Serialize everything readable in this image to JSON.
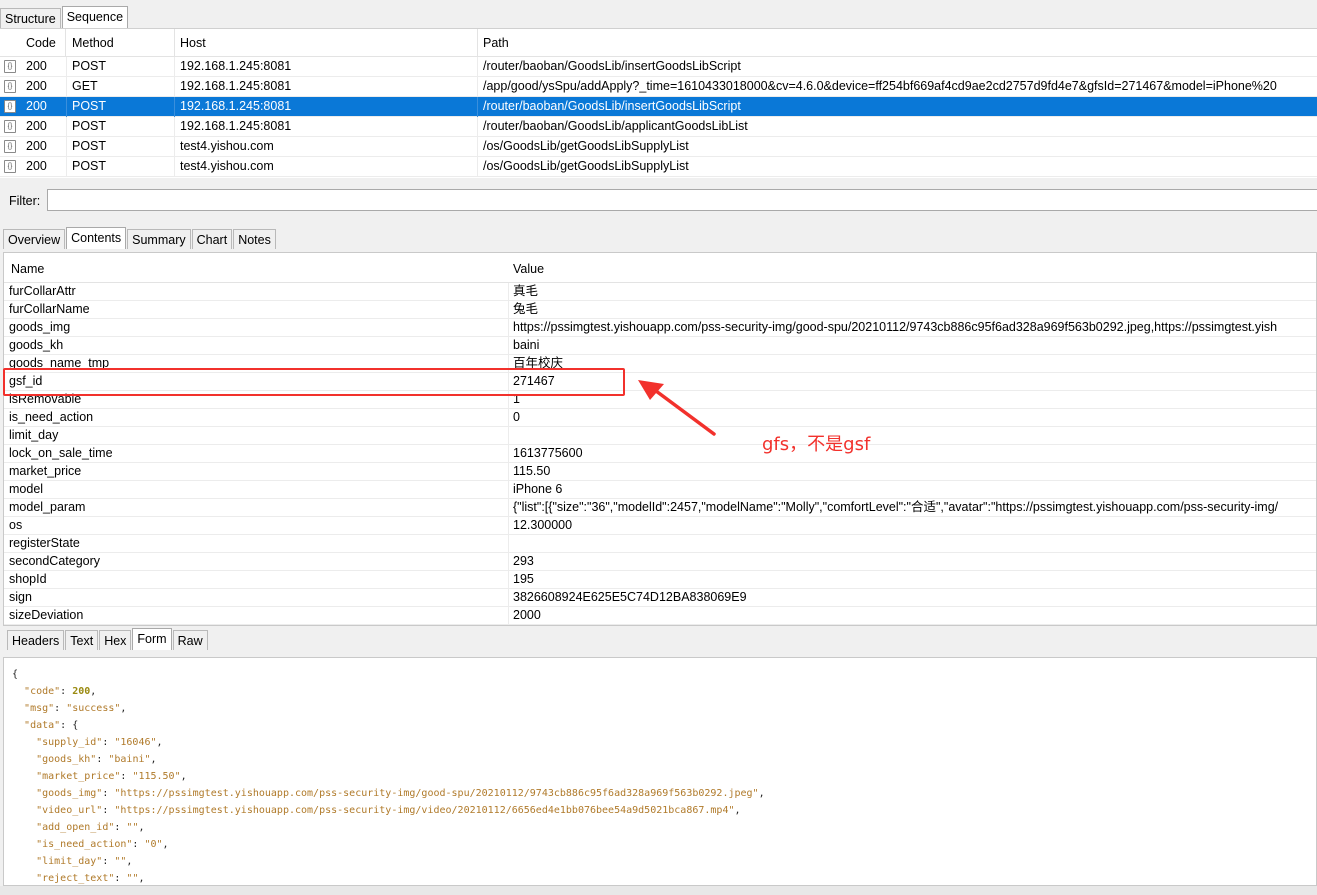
{
  "top_tabs": [
    "Structure",
    "Sequence"
  ],
  "sequence": {
    "columns": [
      "Code",
      "Method",
      "Host",
      "Path"
    ],
    "rows": [
      {
        "code": "200",
        "method": "POST",
        "host": "192.168.1.245:8081",
        "path": "/router/baoban/GoodsLib/insertGoodsLibScript"
      },
      {
        "code": "200",
        "method": "GET",
        "host": "192.168.1.245:8081",
        "path": "/app/good/ysSpu/addApply?_time=1610433018000&cv=4.6.0&device=ff254bf669af4cd9ae2cd2757d9fd4e7&gfsId=271467&model=iPhone%20"
      },
      {
        "code": "200",
        "method": "POST",
        "host": "192.168.1.245:8081",
        "path": "/router/baoban/GoodsLib/insertGoodsLibScript"
      },
      {
        "code": "200",
        "method": "POST",
        "host": "192.168.1.245:8081",
        "path": "/router/baoban/GoodsLib/applicantGoodsLibList"
      },
      {
        "code": "200",
        "method": "POST",
        "host": "test4.yishou.com",
        "path": "/os/GoodsLib/getGoodsLibSupplyList"
      },
      {
        "code": "200",
        "method": "POST",
        "host": "test4.yishou.com",
        "path": "/os/GoodsLib/getGoodsLibSupplyList"
      }
    ],
    "selected_index": 2
  },
  "filter": {
    "label": "Filter:",
    "value": ""
  },
  "detail_tabs": [
    "Overview",
    "Contents",
    "Summary",
    "Chart",
    "Notes"
  ],
  "contents": {
    "columns": [
      "Name",
      "Value"
    ],
    "rows": [
      {
        "name": "furCollarAttr",
        "value": "真毛"
      },
      {
        "name": "furCollarName",
        "value": "兔毛"
      },
      {
        "name": "goods_img",
        "value": "https://pssimgtest.yishouapp.com/pss-security-img/good-spu/20210112/9743cb886c95f6ad328a969f563b0292.jpeg,https://pssimgtest.yish"
      },
      {
        "name": "goods_kh",
        "value": "baini"
      },
      {
        "name": "goods_name_tmp",
        "value": "百年校庆"
      },
      {
        "name": "gsf_id",
        "value": "271467"
      },
      {
        "name": "isRemovable",
        "value": "1"
      },
      {
        "name": "is_need_action",
        "value": "0"
      },
      {
        "name": "limit_day",
        "value": ""
      },
      {
        "name": "lock_on_sale_time",
        "value": "1613775600"
      },
      {
        "name": "market_price",
        "value": "115.50"
      },
      {
        "name": "model",
        "value": "iPhone 6"
      },
      {
        "name": "model_param",
        "value": "{\"list\":[{\"size\":\"36\",\"modelId\":2457,\"modelName\":\"Molly\",\"comfortLevel\":\"合适\",\"avatar\":\"https://pssimgtest.yishouapp.com/pss-security-img/"
      },
      {
        "name": "os",
        "value": "12.300000"
      },
      {
        "name": "registerState",
        "value": ""
      },
      {
        "name": "secondCategory",
        "value": "293"
      },
      {
        "name": "shopId",
        "value": "195"
      },
      {
        "name": "sign",
        "value": "3826608924E625E5C74D12BA838069E9"
      },
      {
        "name": "sizeDeviation",
        "value": "2000"
      }
    ]
  },
  "body_tabs": [
    "Headers",
    "Text",
    "Hex",
    "Form",
    "Raw"
  ],
  "json_lines": [
    [
      {
        "t": "p",
        "s": "{"
      }
    ],
    [
      {
        "t": "p",
        "s": "  "
      },
      {
        "t": "k",
        "s": "\"code\""
      },
      {
        "t": "p",
        "s": ": "
      },
      {
        "t": "n",
        "s": "200"
      },
      {
        "t": "p",
        "s": ","
      }
    ],
    [
      {
        "t": "p",
        "s": "  "
      },
      {
        "t": "k",
        "s": "\"msg\""
      },
      {
        "t": "p",
        "s": ": "
      },
      {
        "t": "s",
        "s": "\"success\""
      },
      {
        "t": "p",
        "s": ","
      }
    ],
    [
      {
        "t": "p",
        "s": "  "
      },
      {
        "t": "k",
        "s": "\"data\""
      },
      {
        "t": "p",
        "s": ": {"
      }
    ],
    [
      {
        "t": "p",
        "s": "    "
      },
      {
        "t": "k",
        "s": "\"supply_id\""
      },
      {
        "t": "p",
        "s": ": "
      },
      {
        "t": "s",
        "s": "\"16046\""
      },
      {
        "t": "p",
        "s": ","
      }
    ],
    [
      {
        "t": "p",
        "s": "    "
      },
      {
        "t": "k",
        "s": "\"goods_kh\""
      },
      {
        "t": "p",
        "s": ": "
      },
      {
        "t": "s",
        "s": "\"baini\""
      },
      {
        "t": "p",
        "s": ","
      }
    ],
    [
      {
        "t": "p",
        "s": "    "
      },
      {
        "t": "k",
        "s": "\"market_price\""
      },
      {
        "t": "p",
        "s": ": "
      },
      {
        "t": "s",
        "s": "\"115.50\""
      },
      {
        "t": "p",
        "s": ","
      }
    ],
    [
      {
        "t": "p",
        "s": "    "
      },
      {
        "t": "k",
        "s": "\"goods_img\""
      },
      {
        "t": "p",
        "s": ": "
      },
      {
        "t": "s",
        "s": "\"https://pssimgtest.yishouapp.com/pss-security-img/good-spu/20210112/9743cb886c95f6ad328a969f563b0292.jpeg\""
      },
      {
        "t": "p",
        "s": ","
      }
    ],
    [
      {
        "t": "p",
        "s": "    "
      },
      {
        "t": "k",
        "s": "\"video_url\""
      },
      {
        "t": "p",
        "s": ": "
      },
      {
        "t": "s",
        "s": "\"https://pssimgtest.yishouapp.com/pss-security-img/video/20210112/6656ed4e1bb076bee54a9d5021bca867.mp4\""
      },
      {
        "t": "p",
        "s": ","
      }
    ],
    [
      {
        "t": "p",
        "s": "    "
      },
      {
        "t": "k",
        "s": "\"add_open_id\""
      },
      {
        "t": "p",
        "s": ": "
      },
      {
        "t": "s",
        "s": "\"\""
      },
      {
        "t": "p",
        "s": ","
      }
    ],
    [
      {
        "t": "p",
        "s": "    "
      },
      {
        "t": "k",
        "s": "\"is_need_action\""
      },
      {
        "t": "p",
        "s": ": "
      },
      {
        "t": "s",
        "s": "\"0\""
      },
      {
        "t": "p",
        "s": ","
      }
    ],
    [
      {
        "t": "p",
        "s": "    "
      },
      {
        "t": "k",
        "s": "\"limit_day\""
      },
      {
        "t": "p",
        "s": ": "
      },
      {
        "t": "s",
        "s": "\"\""
      },
      {
        "t": "p",
        "s": ","
      }
    ],
    [
      {
        "t": "p",
        "s": "    "
      },
      {
        "t": "k",
        "s": "\"reject_text\""
      },
      {
        "t": "p",
        "s": ": "
      },
      {
        "t": "s",
        "s": "\"\""
      },
      {
        "t": "p",
        "s": ","
      }
    ]
  ],
  "annotation": {
    "text": "gfs，不是gsf",
    "color": "#f2312c"
  },
  "colors": {
    "selection": "#0a78d7",
    "annotation": "#f2312c"
  }
}
